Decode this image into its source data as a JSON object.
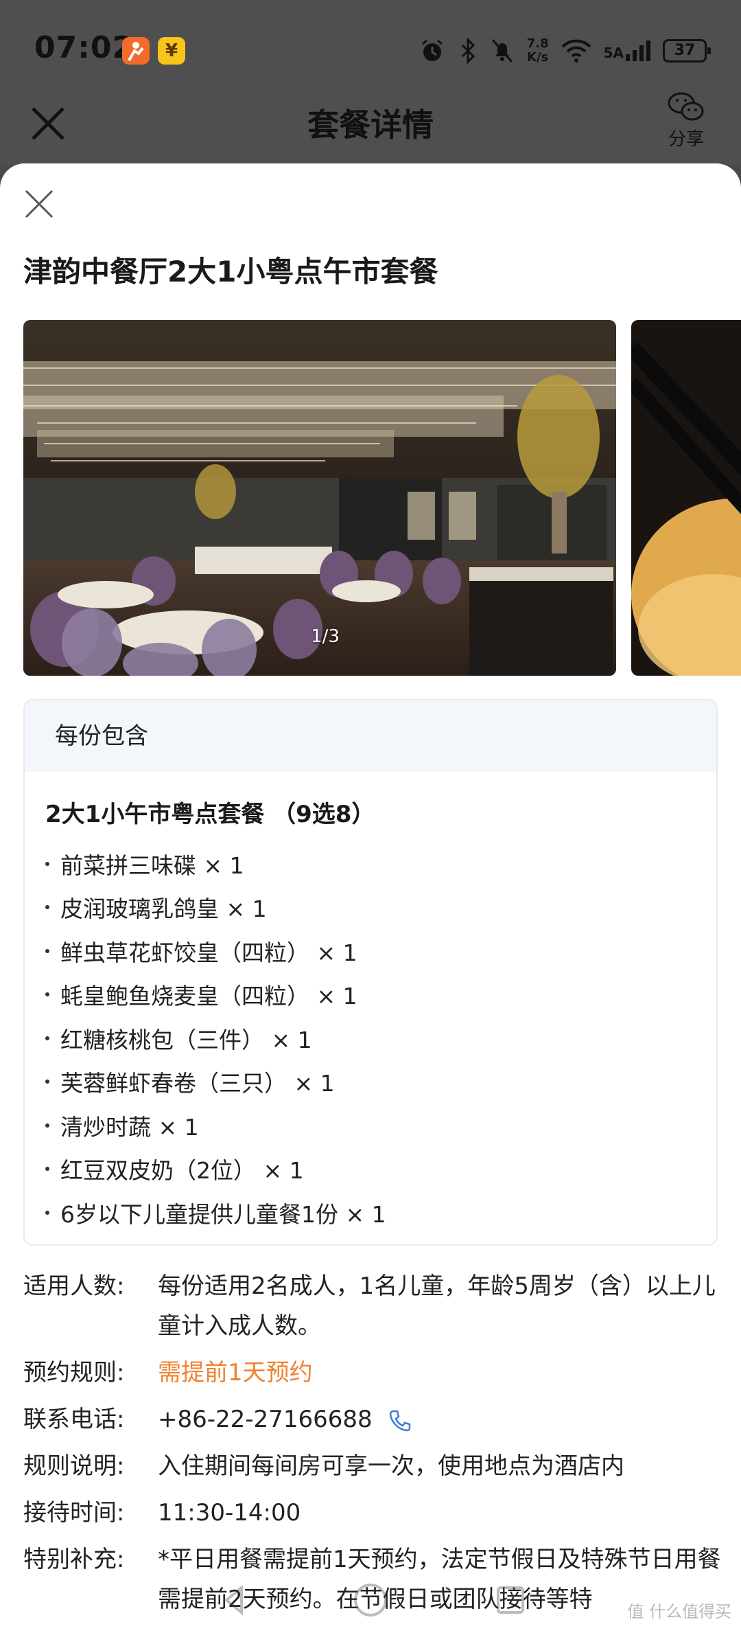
{
  "status_bar": {
    "time": "07:02",
    "app_icons": [
      "¥"
    ],
    "net_speed_value": "7.8",
    "net_speed_unit": "K/s",
    "signal_label": "5A",
    "battery": "37"
  },
  "nav": {
    "title": "套餐详情",
    "share_label": "分享"
  },
  "sheet": {
    "title": "津韵中餐厅2大1小粤点午市套餐",
    "gallery_counter": "1/3"
  },
  "contents": {
    "header": "每份包含",
    "package_name": "2大1小午市粤点套餐 （9选8）",
    "items": [
      {
        "text": "前菜拼三味碟 × 1"
      },
      {
        "text": "皮润玻璃乳鸽皇  × 1"
      },
      {
        "text": "鲜虫草花虾饺皇（四粒） × 1"
      },
      {
        "text": "蚝皇鲍鱼烧麦皇（四粒） × 1"
      },
      {
        "text": "红糖核桃包（三件） × 1"
      },
      {
        "text": "芙蓉鲜虾春卷（三只） × 1"
      },
      {
        "text": "清炒时蔬 × 1"
      },
      {
        "text": "红豆双皮奶（2位） × 1"
      },
      {
        "text": "6岁以下儿童提供儿童餐1份 × 1"
      }
    ]
  },
  "info": {
    "applicable_label": "适用人数:",
    "applicable_value": "每份适用2名成人，1名儿童，年龄5周岁（含）以上儿童计入成人数。",
    "booking_label": "预约规则:",
    "booking_value": "需提前1天预约",
    "phone_label": "联系电话:",
    "phone_value": "+86-22-27166688",
    "rules_label": "规则说明:",
    "rules_value": "入住期间每间房可享一次，使用地点为酒店内",
    "hours_label": "接待时间:",
    "hours_value": "11:30-14:00",
    "extra_label": "特别补充:",
    "extra_value": "*平日用餐需提前1天预约，法定节假日及特殊节日用餐需提前2天预约。在节假日或团队接待等特"
  },
  "colors": {
    "accent_orange": "#f08132",
    "phone_icon_blue": "#3b7ad9",
    "card_header_bg": "#f3f6fb"
  },
  "watermark": "值 什么值得买"
}
